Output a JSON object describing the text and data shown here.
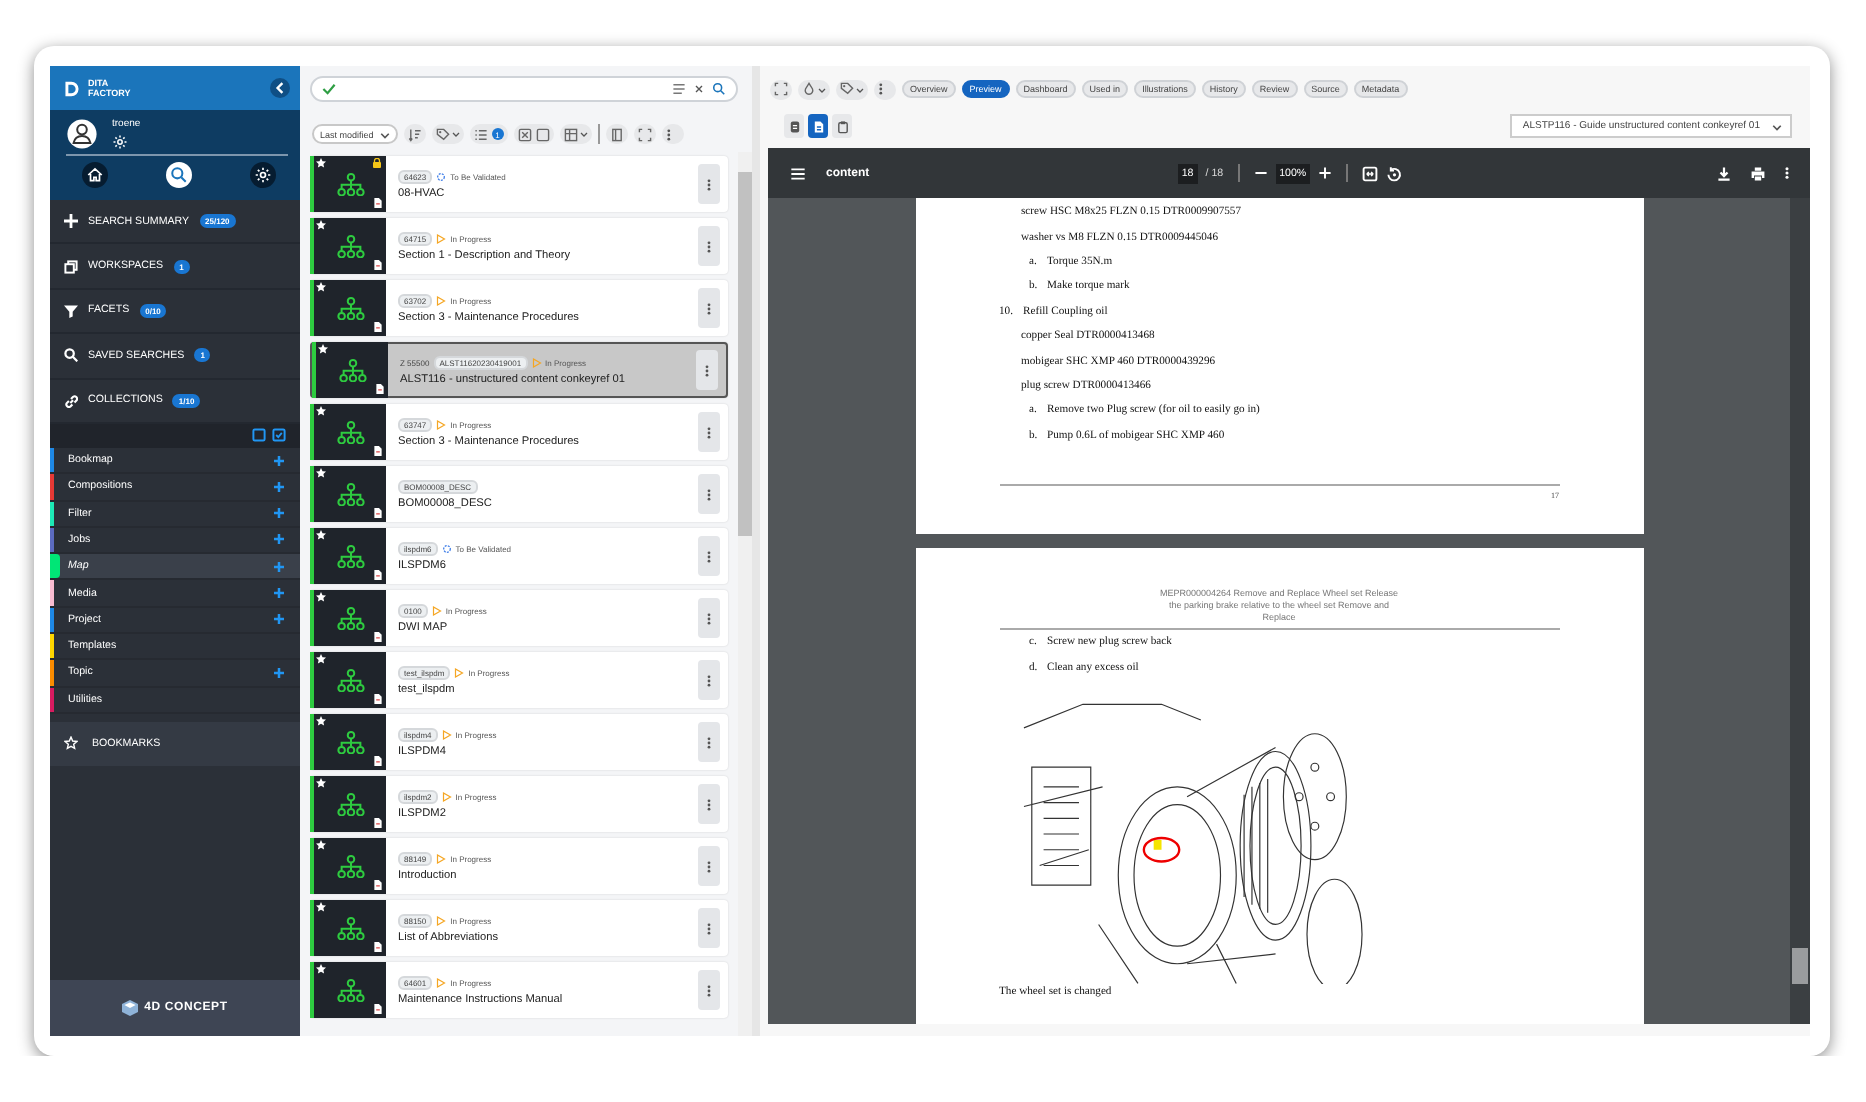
{
  "sidebar": {
    "brand": [
      "DITA",
      "FACTORY"
    ],
    "user": "troene",
    "top_icons": [
      {
        "kind": "home",
        "selected": false
      },
      {
        "kind": "search",
        "selected": true
      },
      {
        "kind": "settings",
        "selected": false
      }
    ],
    "nav": [
      {
        "kind": "summary",
        "label": "SEARCH SUMMARY",
        "badge": "25/120"
      },
      {
        "kind": "workspaces",
        "label": "WORKSPACES",
        "badge": "1"
      },
      {
        "kind": "facets",
        "label": "FACETS",
        "badge": "0/10"
      },
      {
        "kind": "saved",
        "label": "SAVED SEARCHES",
        "badge": "1"
      },
      {
        "kind": "collections",
        "label": "COLLECTIONS",
        "badge": "1/10"
      }
    ],
    "collections": [
      {
        "label": "Bookmap",
        "color": "#1e88e5",
        "selected": false,
        "addable": true
      },
      {
        "label": "Compositions",
        "color": "#e53935",
        "selected": false,
        "addable": true
      },
      {
        "label": "Filter",
        "color": "#1de9b6",
        "selected": false,
        "addable": true
      },
      {
        "label": "Jobs",
        "color": "#5c6bc0",
        "selected": false,
        "addable": true
      },
      {
        "label": "Map",
        "color": "#00e676",
        "selected": true,
        "addable": true
      },
      {
        "label": "Media",
        "color": "#f8bbd0",
        "selected": false,
        "addable": true
      },
      {
        "label": "Project",
        "color": "#1e88e5",
        "selected": false,
        "addable": true
      },
      {
        "label": "Templates",
        "color": "#ffd600",
        "selected": false,
        "addable": false
      },
      {
        "label": "Topic",
        "color": "#fb8c00",
        "selected": false,
        "addable": true
      },
      {
        "label": "Utilities",
        "color": "#d81b60",
        "selected": false,
        "addable": false
      }
    ],
    "bookmarks": "BOOKMARKS",
    "footer": "4D CONCEPT"
  },
  "list": {
    "sort": "Last modified",
    "filter_badge": "1",
    "items": [
      {
        "id": "64623",
        "status": "To Be Validated",
        "kind": "validate",
        "title": "08-HVAC",
        "locked": true,
        "selected": false
      },
      {
        "id": "64715",
        "status": "In Progress",
        "kind": "progress",
        "title": "Section 1 - Description and Theory",
        "locked": false,
        "selected": false
      },
      {
        "id": "63702",
        "status": "In Progress",
        "kind": "progress",
        "title": "Section 3 - Maintenance Procedures",
        "locked": false,
        "selected": false
      },
      {
        "prefix": "Z 55500",
        "id": "ALST11620230419001",
        "status": "In Progress",
        "kind": "progress",
        "title": "ALST116 - unstructured content conkeyref 01",
        "locked": false,
        "selected": true
      },
      {
        "id": "63747",
        "status": "In Progress",
        "kind": "progress",
        "title": "Section 3 - Maintenance Procedures",
        "locked": false,
        "selected": false
      },
      {
        "id": "BOM00008_DESC",
        "title": "BOM00008_DESC",
        "locked": false,
        "selected": false
      },
      {
        "id": "ilspdm6",
        "status": "To Be Validated",
        "kind": "validate",
        "title": "ILSPDM6",
        "locked": false,
        "selected": false
      },
      {
        "id": "0100",
        "status": "In Progress",
        "kind": "progress",
        "title": "DWI MAP",
        "locked": false,
        "selected": false
      },
      {
        "id": "test_ilspdm",
        "status": "In Progress",
        "kind": "progress",
        "title": "test_ilspdm",
        "locked": false,
        "selected": false
      },
      {
        "id": "ilspdm4",
        "status": "In Progress",
        "kind": "progress",
        "title": "ILSPDM4",
        "locked": false,
        "selected": false
      },
      {
        "id": "ilspdm2",
        "status": "In Progress",
        "kind": "progress",
        "title": "ILSPDM2",
        "locked": false,
        "selected": false
      },
      {
        "id": "88149",
        "status": "In Progress",
        "kind": "progress",
        "title": "Introduction",
        "locked": false,
        "selected": false
      },
      {
        "id": "88150",
        "status": "In Progress",
        "kind": "progress",
        "title": "List of Abbreviations",
        "locked": false,
        "selected": false
      },
      {
        "id": "64601",
        "status": "In Progress",
        "kind": "progress",
        "title": "Maintenance Instructions Manual",
        "locked": false,
        "selected": false
      }
    ]
  },
  "detail": {
    "tabs": [
      {
        "label": "Overview",
        "selected": false
      },
      {
        "label": "Preview",
        "selected": true
      },
      {
        "label": "Dashboard",
        "selected": false
      },
      {
        "label": "Used in",
        "selected": false
      },
      {
        "label": "Illustrations",
        "selected": false
      },
      {
        "label": "History",
        "selected": false
      },
      {
        "label": "Review",
        "selected": false
      },
      {
        "label": "Source",
        "selected": false
      },
      {
        "label": "Metadata",
        "selected": false
      }
    ],
    "view_buttons": [
      {
        "kind": "outline",
        "selected": false
      },
      {
        "kind": "document",
        "selected": true
      },
      {
        "kind": "clipboard",
        "selected": false
      }
    ],
    "output": "ALSTP116 - Guide unstructured content conkeyref 01",
    "viewer": {
      "title": "content",
      "page": "18",
      "page_total": "/ 18",
      "zoom": "100%",
      "page_a": {
        "lines": [
          {
            "kind": "note",
            "text": "screw HSC M8x25 FLZN 0.15 DTR0009907557"
          },
          {
            "kind": "note",
            "text": "washer vs M8 FLZN 0.15 DTR0009445046"
          },
          {
            "kind": "sub",
            "marker": "a.",
            "text": "Torque 35N.m"
          },
          {
            "kind": "sub",
            "marker": "b.",
            "text": "Make torque mark"
          },
          {
            "kind": "step",
            "marker": "10.",
            "text": "Refill Coupling oil"
          },
          {
            "kind": "note",
            "text": "copper Seal DTR0000413468"
          },
          {
            "kind": "note",
            "text": "mobigear SHC XMP 460 DTR0000439296"
          },
          {
            "kind": "note",
            "text": "plug screw DTR0000413466"
          },
          {
            "kind": "sub",
            "marker": "a.",
            "text": "Remove two Plug screw (for oil to easily go in)"
          },
          {
            "kind": "sub",
            "marker": "b.",
            "text": "Pump 0.6L of mobigear SHC XMP 460"
          }
        ],
        "number": "17"
      },
      "page_b": {
        "header": "MEPR000004264 Remove and Replace Wheel set Release the parking brake relative to the wheel set Remove and Replace",
        "lines": [
          {
            "kind": "sub",
            "marker": "c.",
            "text": "Screw new plug screw back"
          },
          {
            "kind": "sub",
            "marker": "d.",
            "text": "Clean any excess oil"
          }
        ],
        "after": "The wheel set is changed"
      }
    }
  }
}
